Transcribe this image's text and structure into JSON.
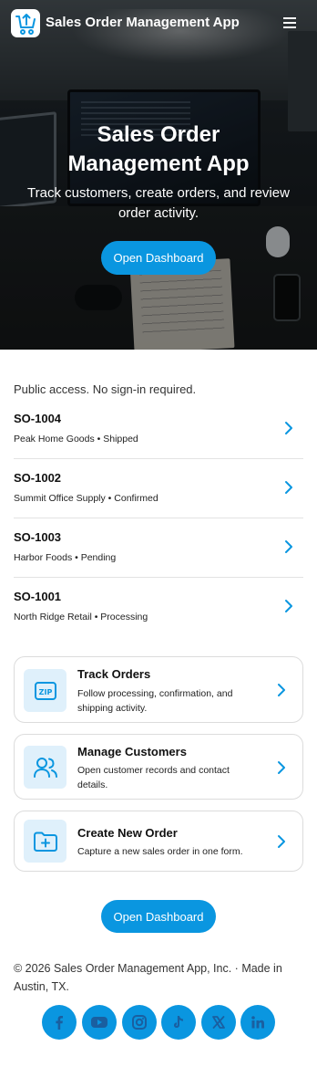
{
  "header": {
    "app_name": "Sales Order Management App",
    "logo_icon": "cart-upload-icon",
    "menu_icon": "hamburger-menu-icon"
  },
  "hero": {
    "title_line1": "Sales Order",
    "title_line2": "Management App",
    "subtitle": "Track customers, create orders, and review order activity.",
    "cta_label": "Open Dashboard"
  },
  "main": {
    "access_note": "Public access. No sign-in required.",
    "orders": [
      {
        "id": "SO-1004",
        "customer": "Peak Home Goods",
        "status": "Shipped"
      },
      {
        "id": "SO-1002",
        "customer": "Summit Office Supply",
        "status": "Confirmed"
      },
      {
        "id": "SO-1003",
        "customer": "Harbor Foods",
        "status": "Pending"
      },
      {
        "id": "SO-1001",
        "customer": "North Ridge Retail",
        "status": "Processing"
      }
    ],
    "order_meta": [
      "Peak Home Goods • Shipped",
      "Summit Office Supply • Confirmed",
      "Harbor Foods • Pending",
      "North Ridge Retail • Processing"
    ],
    "features": [
      {
        "icon": "zip-box-icon",
        "title": "Track Orders",
        "description": "Follow processing, confirmation, and shipping activity."
      },
      {
        "icon": "users-icon",
        "title": "Manage Customers",
        "description": "Open customer records and contact details."
      },
      {
        "icon": "folder-plus-icon",
        "title": "Create New Order",
        "description": "Capture a new sales order in one form."
      }
    ],
    "cta_label": "Open Dashboard"
  },
  "footer": {
    "copyright": "© 2026 Sales Order Management App, Inc. · Made in Austin, TX.",
    "socials": [
      "facebook-icon",
      "youtube-icon",
      "instagram-icon",
      "tiktok-icon",
      "x-icon",
      "linkedin-icon"
    ]
  },
  "colors": {
    "accent": "#0a96e0",
    "icon_bg": "#dff0fb",
    "card_border": "#dcdcdc",
    "divider": "#e3e3e3"
  }
}
